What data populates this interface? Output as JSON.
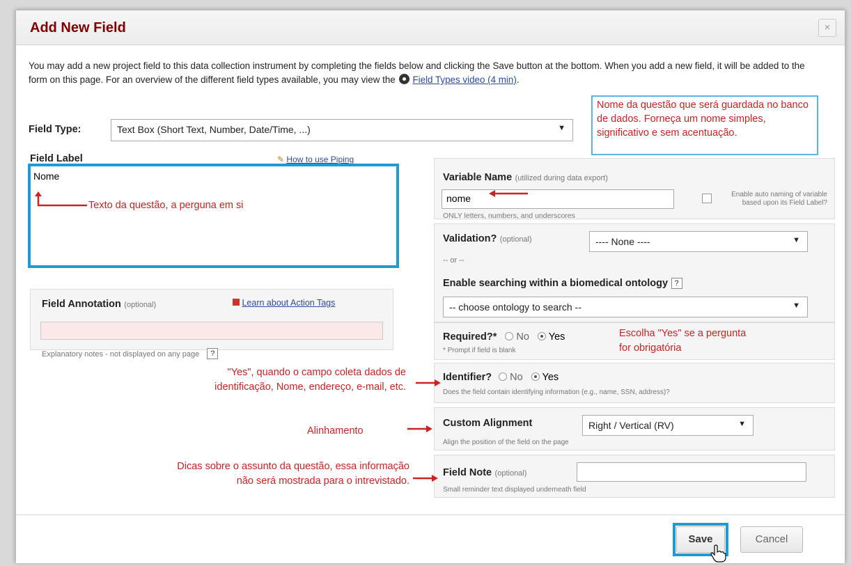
{
  "dialog": {
    "title": "Add New Field",
    "close_label": "×"
  },
  "intro": {
    "text_before": "You may add a new project field to this data collection instrument by completing the fields below and clicking the Save button at the bottom. When you add a new field, it will be added to the form on this page. For an overview of the different field types available, you may view the",
    "video_link": "Field Types video (4 min)",
    "text_after": "."
  },
  "field_type": {
    "label": "Field Type:",
    "value": "Text Box (Short Text, Number, Date/Time, ...)"
  },
  "field_label": {
    "label": "Field Label",
    "piping_link": "How to use Piping",
    "value": "Nome"
  },
  "field_annotation": {
    "label": "Field Annotation",
    "optional": "(optional)",
    "action_tags_link": "Learn about Action Tags",
    "note": "Explanatory notes - not displayed on any page",
    "help": "?"
  },
  "variable_name": {
    "label": "Variable Name",
    "hint": "(utilized during data export)",
    "value": "nome",
    "note": "ONLY letters, numbers, and underscores",
    "auto_naming": "Enable auto naming of variable based upon its Field Label?"
  },
  "validation": {
    "label": "Validation?",
    "optional": "(optional)",
    "value": "---- None ----",
    "or": "-- or --",
    "ontology_label": "Enable searching within a biomedical ontology",
    "help": "?",
    "ontology_value": "-- choose ontology to search --"
  },
  "required": {
    "label": "Required?*",
    "no": "No",
    "yes": "Yes",
    "note": "* Prompt if field is blank"
  },
  "identifier": {
    "label": "Identifier?",
    "no": "No",
    "yes": "Yes",
    "note": "Does the field contain identifying information (e.g., name, SSN, address)?"
  },
  "alignment": {
    "label": "Custom Alignment",
    "value": "Right / Vertical (RV)",
    "note": "Align the position of the field on the page"
  },
  "field_note": {
    "label": "Field Note",
    "optional": "(optional)",
    "value": "",
    "note": "Small reminder text displayed underneath field"
  },
  "annotations": {
    "variable_callout": "Nome da questão que será guardada no banco de dados. Forneça um nome simples, significativo e sem acentuação.",
    "label_note": "Texto da questão, a perguna em si",
    "required_note_1": "Escolha \"Yes\" se a pergunta",
    "required_note_2": "for obrigatória",
    "identifier_note_1": "\"Yes\", quando o campo coleta dados de",
    "identifier_note_2": "identificação, Nome, endereço, e-mail, etc.",
    "alignment_note": "Alinhamento",
    "fieldnote_note_1": "Dicas sobre o assunto da questão, essa informação",
    "fieldnote_note_2": "não será mostrada para o intrevistado."
  },
  "footer": {
    "save": "Save",
    "cancel": "Cancel"
  },
  "colors": {
    "title": "#800000",
    "annotation_red": "#cc2222",
    "highlight_blue": "#1e9ad6"
  }
}
